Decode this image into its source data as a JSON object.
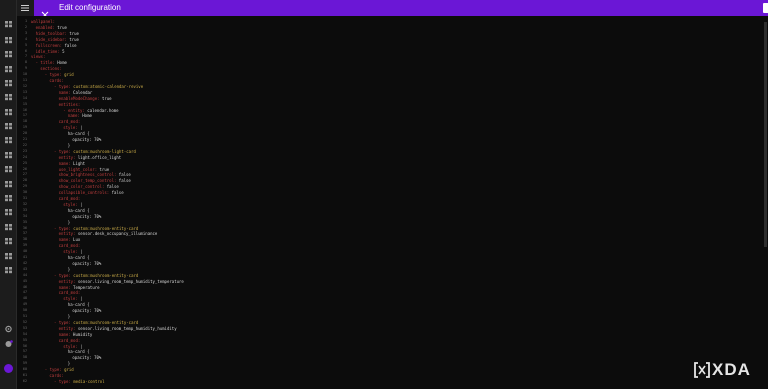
{
  "header": {
    "title": "Edit configuration"
  },
  "sidebar": {
    "icons": [
      "menu-icon",
      "dashboard-icon",
      "energy-icon",
      "map-icon",
      "logbook-icon",
      "history-icon",
      "media-icon",
      "shopping-list-icon",
      "todo-icon",
      "grid-icon",
      "chart-icon",
      "calendar-icon",
      "map-pin-icon",
      "code-icon",
      "tools-icon",
      "search-icon",
      "hacs-icon",
      "terminal-icon",
      "developer-tools-icon",
      "settings-icon",
      "notifications-icon",
      "user-avatar-icon"
    ]
  },
  "editor": {
    "lines": [
      {
        "n": "1",
        "indent": 0,
        "key": "wallpanel:",
        "val": ""
      },
      {
        "n": "2",
        "indent": 1,
        "key": "enabled:",
        "val": "true"
      },
      {
        "n": "3",
        "indent": 1,
        "key": "hide_toolbar:",
        "val": "true"
      },
      {
        "n": "4",
        "indent": 1,
        "key": "hide_sidebar:",
        "val": "true"
      },
      {
        "n": "5",
        "indent": 1,
        "key": "fullscreen:",
        "val": "false"
      },
      {
        "n": "6",
        "indent": 1,
        "key": "idle_time:",
        "val": "5"
      },
      {
        "n": "7",
        "indent": 0,
        "key": "views:",
        "val": ""
      },
      {
        "n": "8",
        "indent": 1,
        "key": "- title:",
        "val": "Home"
      },
      {
        "n": "9",
        "indent": 2,
        "key": "sections:",
        "val": ""
      },
      {
        "n": "10",
        "indent": 3,
        "key": "- type:",
        "val": "grid"
      },
      {
        "n": "11",
        "indent": 4,
        "key": "cards:",
        "val": ""
      },
      {
        "n": "12",
        "indent": 5,
        "key": "- type:",
        "val": "custom:atomic-calendar-revive"
      },
      {
        "n": "13",
        "indent": 6,
        "key": "name:",
        "val": "Calendar"
      },
      {
        "n": "14",
        "indent": 6,
        "key": "enableModeChange:",
        "val": "true"
      },
      {
        "n": "15",
        "indent": 6,
        "key": "entities:",
        "val": ""
      },
      {
        "n": "16",
        "indent": 7,
        "key": "- entity:",
        "val": "calendar.home"
      },
      {
        "n": "17",
        "indent": 8,
        "key": "name:",
        "val": "Home"
      },
      {
        "n": "18",
        "indent": 6,
        "key": "card_mod:",
        "val": ""
      },
      {
        "n": "19",
        "indent": 7,
        "key": "style:",
        "val": "|"
      },
      {
        "n": "20",
        "indent": 8,
        "key": "",
        "val": "ha-card {"
      },
      {
        "n": "21",
        "indent": 9,
        "key": "",
        "val": "opacity: 70%"
      },
      {
        "n": "22",
        "indent": 8,
        "key": "",
        "val": "}"
      },
      {
        "n": "23",
        "indent": 5,
        "key": "- type:",
        "val": "custom:mushroom-light-card"
      },
      {
        "n": "24",
        "indent": 6,
        "key": "entity:",
        "val": "light.office_light"
      },
      {
        "n": "25",
        "indent": 6,
        "key": "name:",
        "val": "Light"
      },
      {
        "n": "26",
        "indent": 6,
        "key": "use_light_color:",
        "val": "true"
      },
      {
        "n": "27",
        "indent": 6,
        "key": "show_brightness_control:",
        "val": "false"
      },
      {
        "n": "28",
        "indent": 6,
        "key": "show_color_temp_control:",
        "val": "false"
      },
      {
        "n": "29",
        "indent": 6,
        "key": "show_color_control:",
        "val": "false"
      },
      {
        "n": "30",
        "indent": 6,
        "key": "collapsible_controls:",
        "val": "false"
      },
      {
        "n": "31",
        "indent": 6,
        "key": "card_mod:",
        "val": ""
      },
      {
        "n": "32",
        "indent": 7,
        "key": "style:",
        "val": "|"
      },
      {
        "n": "33",
        "indent": 8,
        "key": "",
        "val": "ha-card {"
      },
      {
        "n": "34",
        "indent": 9,
        "key": "",
        "val": "opacity: 70%"
      },
      {
        "n": "35",
        "indent": 8,
        "key": "",
        "val": "}"
      },
      {
        "n": "36",
        "indent": 5,
        "key": "- type:",
        "val": "custom:mushroom-entity-card"
      },
      {
        "n": "37",
        "indent": 6,
        "key": "entity:",
        "val": "sensor.desk_occupancy_illuminance"
      },
      {
        "n": "38",
        "indent": 6,
        "key": "name:",
        "val": "Lux"
      },
      {
        "n": "39",
        "indent": 6,
        "key": "card_mod:",
        "val": ""
      },
      {
        "n": "40",
        "indent": 7,
        "key": "style:",
        "val": "|"
      },
      {
        "n": "41",
        "indent": 8,
        "key": "",
        "val": "ha-card {"
      },
      {
        "n": "42",
        "indent": 9,
        "key": "",
        "val": "opacity: 70%"
      },
      {
        "n": "43",
        "indent": 8,
        "key": "",
        "val": "}"
      },
      {
        "n": "44",
        "indent": 5,
        "key": "- type:",
        "val": "custom:mushroom-entity-card"
      },
      {
        "n": "45",
        "indent": 6,
        "key": "entity:",
        "val": "sensor.living_room_temp_humidity_temperature"
      },
      {
        "n": "46",
        "indent": 6,
        "key": "name:",
        "val": "Temperature"
      },
      {
        "n": "47",
        "indent": 6,
        "key": "card_mod:",
        "val": ""
      },
      {
        "n": "48",
        "indent": 7,
        "key": "style:",
        "val": "|"
      },
      {
        "n": "49",
        "indent": 8,
        "key": "",
        "val": "ha-card {"
      },
      {
        "n": "50",
        "indent": 9,
        "key": "",
        "val": "opacity: 70%"
      },
      {
        "n": "51",
        "indent": 8,
        "key": "",
        "val": "}"
      },
      {
        "n": "52",
        "indent": 5,
        "key": "- type:",
        "val": "custom:mushroom-entity-card"
      },
      {
        "n": "53",
        "indent": 6,
        "key": "entity:",
        "val": "sensor.living_room_temp_humidity_humidity"
      },
      {
        "n": "54",
        "indent": 6,
        "key": "name:",
        "val": "Humidity"
      },
      {
        "n": "55",
        "indent": 6,
        "key": "card_mod:",
        "val": ""
      },
      {
        "n": "56",
        "indent": 7,
        "key": "style:",
        "val": "|"
      },
      {
        "n": "57",
        "indent": 8,
        "key": "",
        "val": "ha-card {"
      },
      {
        "n": "58",
        "indent": 9,
        "key": "",
        "val": "opacity: 70%"
      },
      {
        "n": "59",
        "indent": 8,
        "key": "",
        "val": "}"
      },
      {
        "n": "60",
        "indent": 3,
        "key": "- type:",
        "val": "grid"
      },
      {
        "n": "61",
        "indent": 4,
        "key": "cards:",
        "val": ""
      },
      {
        "n": "62",
        "indent": 5,
        "key": "- type:",
        "val": "media-control"
      }
    ]
  },
  "watermark": {
    "text": "XDA"
  },
  "colors": {
    "accent": "#6b17d6",
    "key": "#c43f3f",
    "value": "#d8d8d8",
    "type_value": "#d1b14a",
    "editor_bg": "#0c0c0c"
  }
}
